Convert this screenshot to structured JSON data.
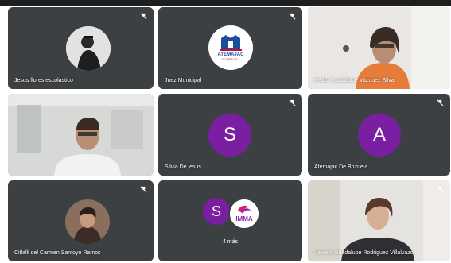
{
  "participants": [
    {
      "name": "Jesus flores escolastico"
    },
    {
      "name": "Juez Municipal",
      "logo_text": "ATEMAJAC",
      "logo_subtext": "DE BRIZUELA"
    },
    {
      "name": "Pedro Guadalupe Vazquez Silva"
    },
    {
      "name": ""
    },
    {
      "name": "Silvia De jesus",
      "initial": "S"
    },
    {
      "name": "Atemajac De Brizuela",
      "initial": "A"
    },
    {
      "name": "Citlalli del Carmen Santoyo Ramos"
    },
    {
      "overflow_initial": "S",
      "overflow_badge": "IMMA",
      "more_label": "4 más"
    },
    {
      "name": "Vanesa Guadalupe Rodriguez Villalvazo"
    }
  ],
  "colors": {
    "tile_bg": "#3c4043",
    "avatar_purple": "#7b1fa2",
    "screen_bg": "#ffffff"
  },
  "icons": [
    "mic-off-icon"
  ]
}
